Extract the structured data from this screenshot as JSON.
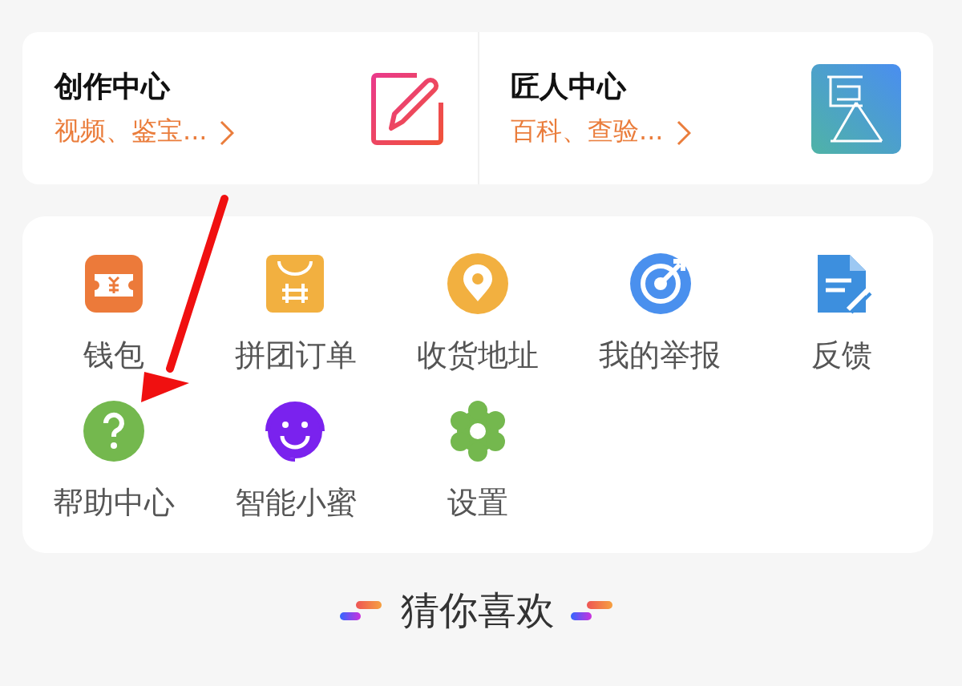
{
  "entries": [
    {
      "title": "创作中心",
      "subtitle": "视频、鉴宝..."
    },
    {
      "title": "匠人中心",
      "subtitle": "百科、查验..."
    }
  ],
  "tools": [
    {
      "label": "钱包"
    },
    {
      "label": "拼团订单"
    },
    {
      "label": "收货地址"
    },
    {
      "label": "我的举报"
    },
    {
      "label": "反馈"
    },
    {
      "label": "帮助中心"
    },
    {
      "label": "智能小蜜"
    },
    {
      "label": "设置"
    }
  ],
  "recommend": {
    "title": "猜你喜欢"
  }
}
